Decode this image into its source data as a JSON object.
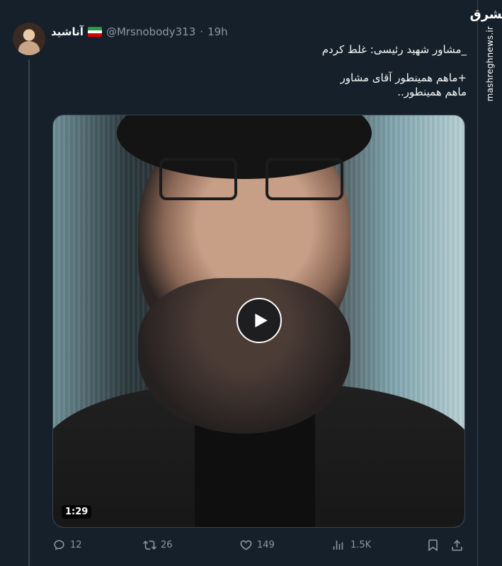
{
  "tweet": {
    "display_name": "آناشید",
    "handle": "@Mrsnobody313",
    "separator": "·",
    "time": "19h",
    "text": "_مشاور شهید رئیسی: غلط کردم\n\n+ماهم همینطور آقای مشاور\nماهم همینطور..",
    "media": {
      "duration": "1:29"
    }
  },
  "actions": {
    "reply_count": "12",
    "retweet_count": "26",
    "like_count": "149",
    "view_count": "1.5K"
  },
  "watermark": {
    "logo_text": "مشرق",
    "site": "mashreghnews.ir"
  },
  "icons": {
    "avatar": "user-avatar",
    "flag": "iran-flag-icon",
    "play": "play-icon",
    "reply": "reply-icon",
    "retweet": "retweet-icon",
    "like": "heart-icon",
    "views": "bar-chart-icon",
    "bookmark": "bookmark-icon",
    "share": "share-icon"
  },
  "colors": {
    "background": "#15202b",
    "secondary_text": "#8b98a5",
    "primary_text": "#f7f9f9"
  }
}
